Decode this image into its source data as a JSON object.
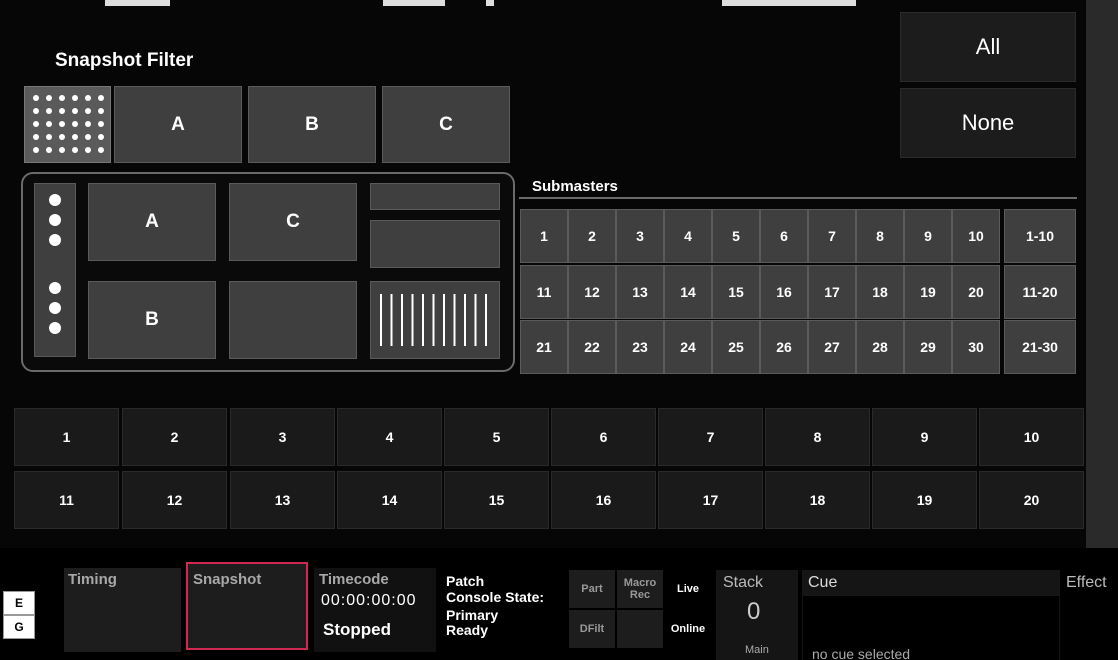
{
  "snapshot_filter": {
    "title": "Snapshot Filter",
    "buttons": [
      "A",
      "B",
      "C"
    ],
    "all": "All",
    "none": "None"
  },
  "preview": {
    "a": "A",
    "b": "B",
    "c": "C"
  },
  "submasters": {
    "title": "Submasters",
    "rows": [
      [
        "1",
        "2",
        "3",
        "4",
        "5",
        "6",
        "7",
        "8",
        "9",
        "10"
      ],
      [
        "11",
        "12",
        "13",
        "14",
        "15",
        "16",
        "17",
        "18",
        "19",
        "20"
      ],
      [
        "21",
        "22",
        "23",
        "24",
        "25",
        "26",
        "27",
        "28",
        "29",
        "30"
      ]
    ],
    "ranges": [
      "1-10",
      "11-20",
      "21-30"
    ]
  },
  "snapshots": {
    "row1": [
      "1",
      "2",
      "3",
      "4",
      "5",
      "6",
      "7",
      "8",
      "9",
      "10"
    ],
    "row2": [
      "11",
      "12",
      "13",
      "14",
      "15",
      "16",
      "17",
      "18",
      "19",
      "20"
    ]
  },
  "status": {
    "e": "E",
    "g": "G",
    "timing": "Timing",
    "snapshot": "Snapshot",
    "timecode_label": "Timecode",
    "timecode_value": "00:00:00:00",
    "timecode_state": "Stopped",
    "patch": "Patch",
    "console_state": "Console State:",
    "primary": "Primary",
    "ready": "Ready",
    "part": "Part",
    "macro_rec": "Macro Rec",
    "live": "Live",
    "dfilt": "DFilt",
    "online": "Online",
    "stack_label": "Stack",
    "stack_value": "0",
    "stack_sub": "Main",
    "cue_label": "Cue",
    "cue_value": "no cue selected",
    "effect": "Effect"
  }
}
